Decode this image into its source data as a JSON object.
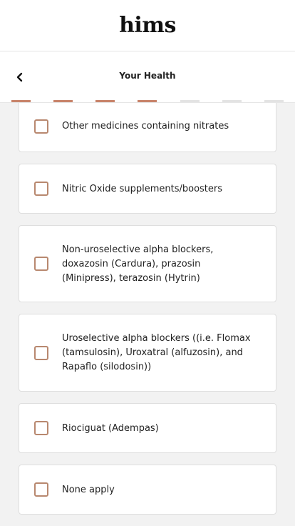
{
  "brand": {
    "logo_text": "hims"
  },
  "header": {
    "title": "Your Health",
    "back_icon": "chevron-left-icon"
  },
  "progress": {
    "total_steps": 7,
    "completed_steps": 4,
    "accent_color": "#c8836a",
    "inactive_color": "#e3e3e3"
  },
  "options": [
    {
      "label": "Other medicines containing nitrates",
      "checked": false
    },
    {
      "label": "Nitric Oxide supplements/boosters",
      "checked": false
    },
    {
      "label": "Non-uroselective alpha blockers, doxazosin (Cardura), prazosin (Minipress), terazosin (Hytrin)",
      "checked": false
    },
    {
      "label": "Uroselective alpha blockers ((i.e. Flomax (tamsulosin), Uroxatral (alfuzosin), and Rapaflo (silodosin))",
      "checked": false
    },
    {
      "label": "Riociguat (Adempas)",
      "checked": false
    },
    {
      "label": "None apply",
      "checked": false
    }
  ]
}
